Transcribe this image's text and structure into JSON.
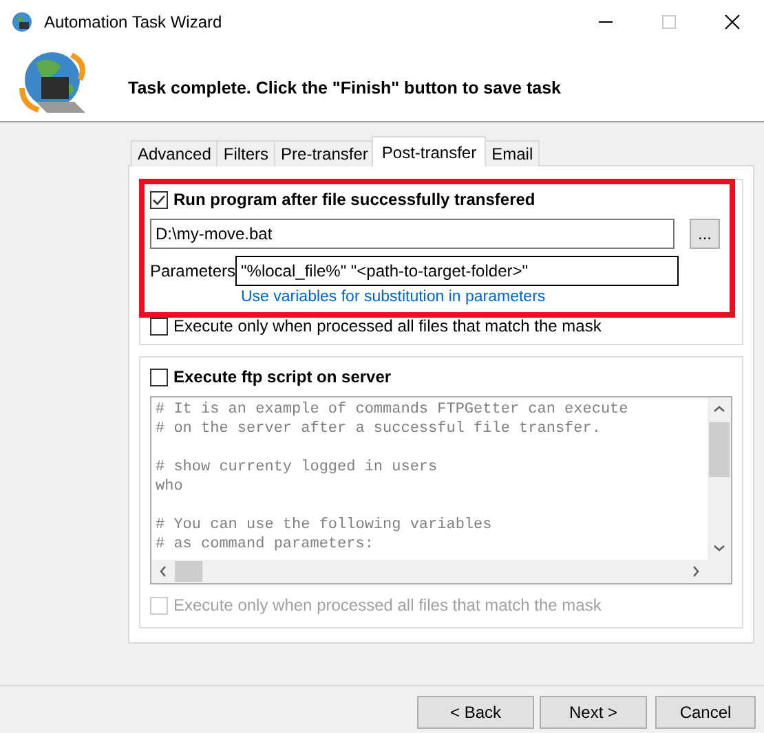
{
  "window": {
    "title": "Automation Task Wizard"
  },
  "header": {
    "message": "Task complete. Click the \"Finish\" button to save task"
  },
  "tabs": [
    {
      "label": "Advanced",
      "selected": false
    },
    {
      "label": "Filters",
      "selected": false
    },
    {
      "label": "Pre-transfer",
      "selected": false
    },
    {
      "label": "Post-transfer",
      "selected": true
    },
    {
      "label": "Email",
      "selected": false
    }
  ],
  "run_program": {
    "label": "Run program after file successfully transfered",
    "checked": true,
    "path": "D:\\my-move.bat",
    "browse": "...",
    "parameters_label": "Parameters",
    "parameters": "\"%local_file%\" \"<path-to-target-folder>\"",
    "link": "Use variables for substitution in parameters",
    "highlighted": true
  },
  "run_program_mask": {
    "label": "Execute only when processed all files that match the mask",
    "checked": false,
    "disabled": false
  },
  "ftp_script": {
    "label": "Execute ftp script on server",
    "checked": false,
    "blocks": [
      [
        "# It is an example of commands FTPGetter can execute",
        "# on the server after a successful file transfer."
      ],
      [
        "# show currenty logged in users",
        "who"
      ],
      [
        "# You can use the following variables",
        "# as command parameters:"
      ]
    ]
  },
  "ftp_script_mask": {
    "label": "Execute only when processed all files that match the mask",
    "checked": false,
    "disabled": true
  },
  "buttons": [
    {
      "label": "< Back"
    },
    {
      "label": "Next >"
    },
    {
      "label": "Cancel"
    }
  ]
}
